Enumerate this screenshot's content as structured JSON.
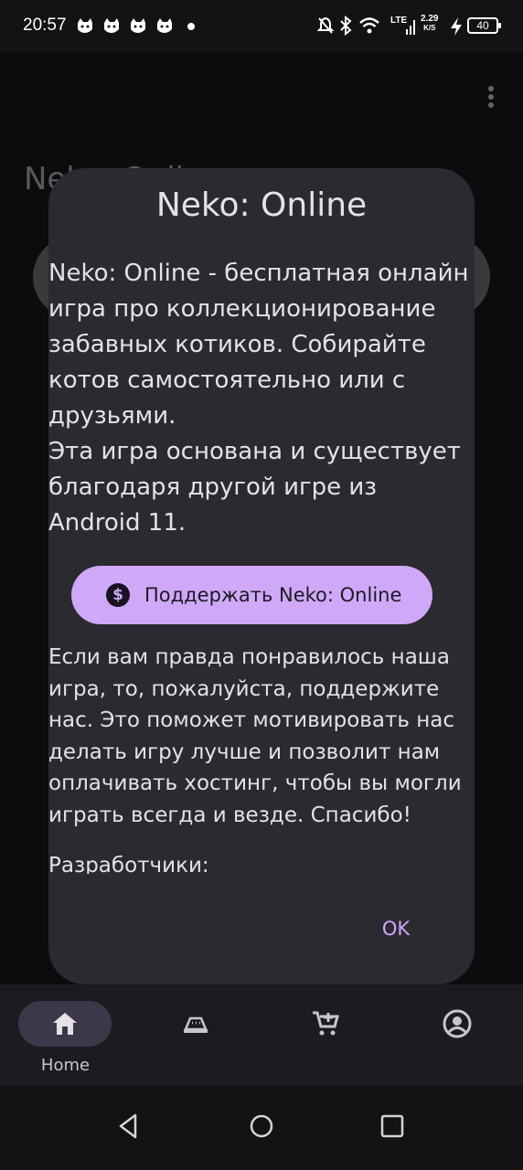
{
  "status_bar": {
    "time": "20:57",
    "network": "LTE",
    "speed_value": "2.29",
    "speed_unit": "K/S",
    "battery": "40",
    "notification_icons": [
      "cat-app-icon",
      "cat-app-icon",
      "cat-app-icon",
      "cat-app-icon"
    ],
    "system_icons": [
      "muted-bell-icon",
      "bluetooth-icon",
      "wifi-icon",
      "signal-icon",
      "charging-icon"
    ]
  },
  "background": {
    "title": "Neko: Online"
  },
  "dialog": {
    "title": "Neko: Online",
    "paragraph1": "Neko: Online - бесплатная онлайн\nигра про коллекционирование\nзабавных котиков. Собирайте\nкотов самостоятельно или с\nдрузьями.\nЭта игра основана и существует\nблагодаря другой игре из\nAndroid 11.",
    "support_button": "Поддержать Neko: Online",
    "paragraph2": "Если вам правда понравилось наша\nигра, то, пожалуйста, поддержите\nнас. Это поможет мотивировать нас\nделать игру лучше и позволит нам\nоплачивать хостинг, чтобы вы могли\nиграть всегда и везде. Спасибо!",
    "developers_label": "Разработчики:",
    "ok_button": "OK"
  },
  "bottom_nav": {
    "items": [
      {
        "label": "Home",
        "icon": "home-icon",
        "selected": true
      },
      {
        "label": "",
        "icon": "food-bowl-icon",
        "selected": false
      },
      {
        "label": "",
        "icon": "cart-icon",
        "selected": false
      },
      {
        "label": "",
        "icon": "account-icon",
        "selected": false
      }
    ]
  },
  "colors": {
    "accent": "#cfa9f8",
    "dialog_bg": "#2b2a30",
    "nav_pill": "#3c3849"
  }
}
